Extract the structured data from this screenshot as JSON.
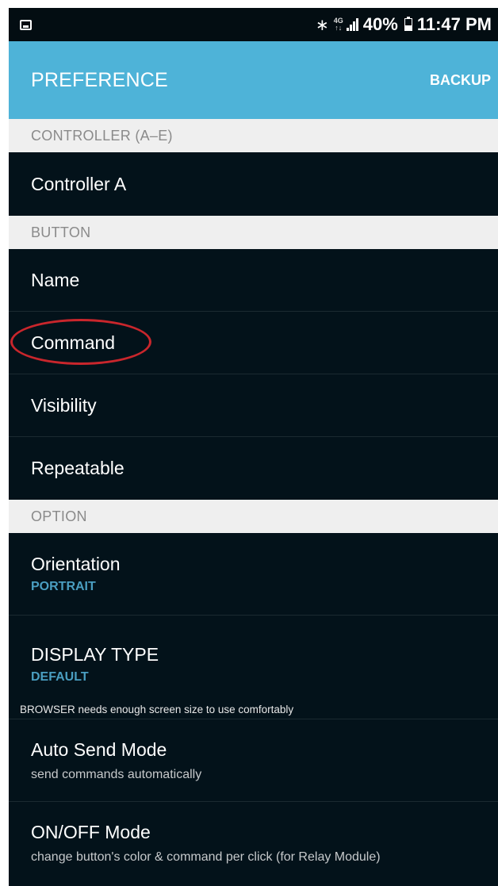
{
  "status_bar": {
    "icons": [
      "image-icon",
      "bluetooth-icon",
      "network-4g-icon",
      "signal-icon",
      "battery-icon"
    ],
    "network": "4G",
    "battery": "40%",
    "time": "11:47 PM"
  },
  "app_bar": {
    "title": "PREFERENCE",
    "action": "BACKUP",
    "color": "#4eb3d8"
  },
  "sections": {
    "controller": {
      "header": "CONTROLLER (A–E)",
      "items": [
        {
          "title": "Controller A"
        }
      ]
    },
    "button": {
      "header": "BUTTON",
      "items": [
        {
          "title": "Name"
        },
        {
          "title": "Command",
          "highlighted": true
        },
        {
          "title": "Visibility"
        },
        {
          "title": "Repeatable"
        }
      ]
    },
    "option": {
      "header": "OPTION",
      "items": [
        {
          "title": "Orientation",
          "summary": "PORTRAIT"
        },
        {
          "title": "DISPLAY TYPE",
          "summary": "DEFAULT",
          "note": "BROWSER needs enough screen size to use comfortably"
        },
        {
          "title": "Auto Send Mode",
          "summary": "send commands automatically"
        },
        {
          "title": "ON/OFF Mode",
          "summary": "change button's color & command per click (for Relay Module)"
        }
      ]
    }
  },
  "colors": {
    "background": "#03121a",
    "section_header_bg": "#efefef",
    "summary_accent": "#4a9ec1",
    "highlight_ring": "#c9262c"
  }
}
